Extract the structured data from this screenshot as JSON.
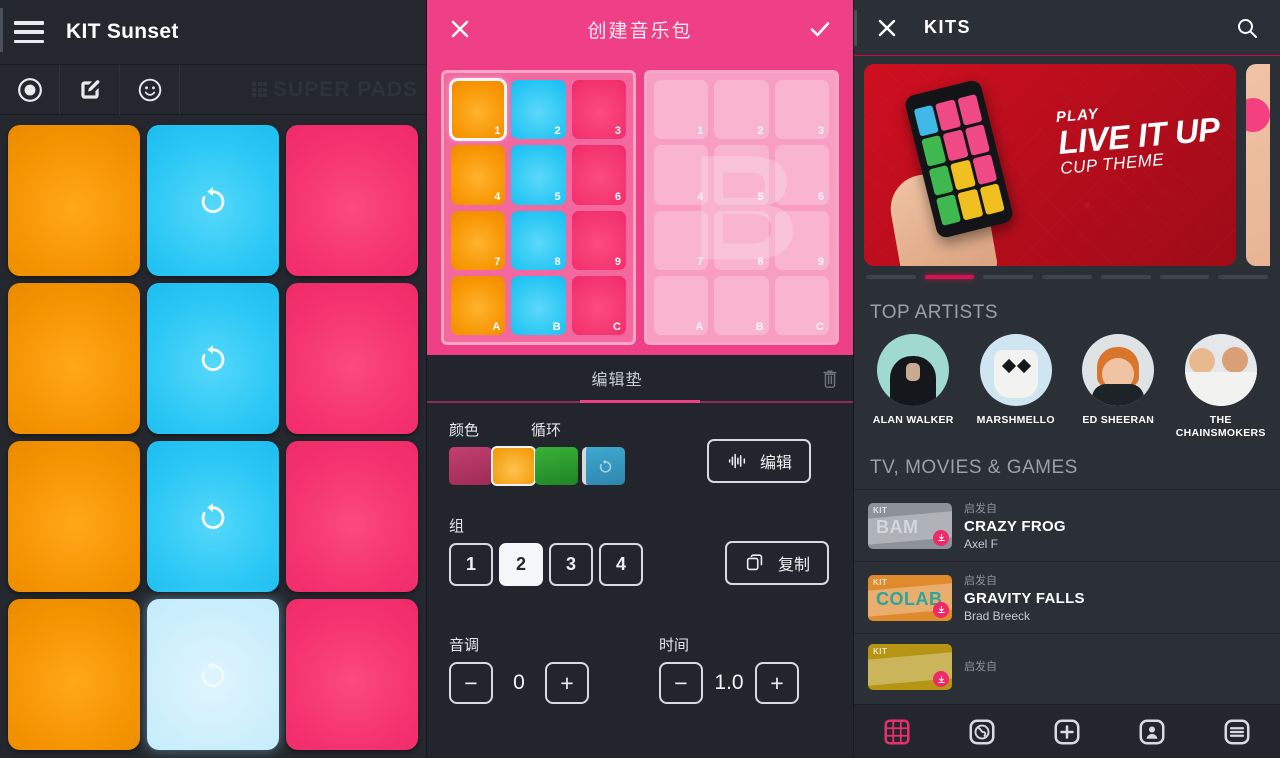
{
  "left": {
    "header": {
      "menu_icon": "hamburger-icon",
      "title": "KIT Sunset"
    },
    "toolbar": {
      "record_icon": "record-icon",
      "edit_icon": "edit-pencil-icon",
      "emoji_icon": "smiley-icon",
      "watermark": "SUPER PADS"
    },
    "pads": [
      {
        "id": "1",
        "color": "orange",
        "loop": false,
        "state": "idle"
      },
      {
        "id": "2",
        "color": "cyan",
        "loop": true,
        "state": "idle"
      },
      {
        "id": "3",
        "color": "pink",
        "loop": false,
        "state": "idle"
      },
      {
        "id": "4",
        "color": "orange",
        "loop": false,
        "state": "idle"
      },
      {
        "id": "5",
        "color": "cyan",
        "loop": true,
        "state": "idle"
      },
      {
        "id": "6",
        "color": "pink",
        "loop": false,
        "state": "idle"
      },
      {
        "id": "7",
        "color": "orange",
        "loop": false,
        "state": "idle"
      },
      {
        "id": "8",
        "color": "cyan",
        "loop": true,
        "state": "idle"
      },
      {
        "id": "9",
        "color": "pink",
        "loop": false,
        "state": "idle"
      },
      {
        "id": "A",
        "color": "orange",
        "loop": false,
        "state": "idle"
      },
      {
        "id": "B",
        "color": "cyan",
        "loop": true,
        "state": "active"
      },
      {
        "id": "C",
        "color": "pink",
        "loop": false,
        "state": "idle"
      }
    ]
  },
  "middle": {
    "header": {
      "close_icon": "close-x-icon",
      "title": "创建音乐包",
      "confirm_icon": "check-icon"
    },
    "grid_a": {
      "pads": [
        {
          "id": "1",
          "color": "o",
          "selected": true
        },
        {
          "id": "2",
          "color": "c",
          "selected": false
        },
        {
          "id": "3",
          "color": "p",
          "selected": false
        },
        {
          "id": "4",
          "color": "o",
          "selected": false
        },
        {
          "id": "5",
          "color": "c",
          "selected": false
        },
        {
          "id": "6",
          "color": "p",
          "selected": false
        },
        {
          "id": "7",
          "color": "o",
          "selected": false
        },
        {
          "id": "8",
          "color": "c",
          "selected": false
        },
        {
          "id": "9",
          "color": "p",
          "selected": false
        },
        {
          "id": "A",
          "color": "o",
          "selected": false
        },
        {
          "id": "B",
          "color": "c",
          "selected": false
        },
        {
          "id": "C",
          "color": "p",
          "selected": false
        }
      ]
    },
    "grid_b": {
      "watermark": "B",
      "pads": [
        {
          "id": "1"
        },
        {
          "id": "2"
        },
        {
          "id": "3"
        },
        {
          "id": "4"
        },
        {
          "id": "5"
        },
        {
          "id": "6"
        },
        {
          "id": "7"
        },
        {
          "id": "8"
        },
        {
          "id": "9"
        },
        {
          "id": "A"
        },
        {
          "id": "B"
        },
        {
          "id": "C"
        }
      ]
    },
    "tab": {
      "label": "编辑垫",
      "trash_icon": "trash-icon"
    },
    "color_section": {
      "label": "颜色",
      "swatches": [
        {
          "name": "magenta",
          "hex": "#b8336a",
          "selected": false
        },
        {
          "name": "orange",
          "hex": "#f7a01a",
          "selected": true
        },
        {
          "name": "green",
          "hex": "#2c9e2c",
          "selected": false
        }
      ]
    },
    "loop_section": {
      "label": "循环",
      "icon": "loop-icon",
      "enabled": true
    },
    "edit_button": {
      "label": "编辑",
      "icon": "waveform-icon"
    },
    "group_section": {
      "label": "组",
      "options": [
        "1",
        "2",
        "3",
        "4"
      ],
      "selected": "2"
    },
    "copy_button": {
      "label": "复制",
      "icon": "copy-icon"
    },
    "pitch": {
      "label": "音调",
      "value": "0",
      "minus": "−",
      "plus": "+"
    },
    "time": {
      "label": "时间",
      "value": "1.0",
      "minus": "−",
      "plus": "+"
    }
  },
  "right": {
    "header": {
      "close_icon": "close-x-icon",
      "title": "KITS",
      "search_icon": "search-icon"
    },
    "banner": {
      "line1": "PLAY",
      "line2": "LIVE IT UP",
      "line3": "CUP THEME"
    },
    "carousel": {
      "count": 7,
      "active_index": 1
    },
    "artists_section": {
      "title": "TOP ARTISTS",
      "artists": [
        {
          "name": "ALAN WALKER"
        },
        {
          "name": "MARSHMELLO"
        },
        {
          "name": "ED SHEERAN"
        },
        {
          "name": "THE CHAINSMOKERS"
        }
      ]
    },
    "kits_section": {
      "title": "TV, MOVIES & GAMES",
      "items": [
        {
          "thumb_kit_label": "KIT",
          "thumb_name": "BAM",
          "thumb_color": "#8d9298",
          "thumb_text_color": "#d4d8dc",
          "inspired_label": "启发自",
          "name": "CRAZY FROG",
          "artist": "Axel F"
        },
        {
          "thumb_kit_label": "KIT",
          "thumb_name": "COLAB",
          "thumb_color": "#e08a2e",
          "thumb_text_color": "#2aa5a0",
          "inspired_label": "启发自",
          "name": "GRAVITY FALLS",
          "artist": "Brad Breeck"
        },
        {
          "thumb_kit_label": "KIT",
          "thumb_name": "",
          "thumb_color": "#b59513",
          "thumb_text_color": "#ded6a0",
          "inspired_label": "启发自",
          "name": "",
          "artist": ""
        }
      ]
    },
    "bottom_nav": [
      {
        "name": "pads-grid-icon",
        "active": true
      },
      {
        "name": "globe-icon",
        "active": false
      },
      {
        "name": "plus-icon",
        "active": false
      },
      {
        "name": "person-icon",
        "active": false
      },
      {
        "name": "list-menu-icon",
        "active": false
      }
    ]
  }
}
